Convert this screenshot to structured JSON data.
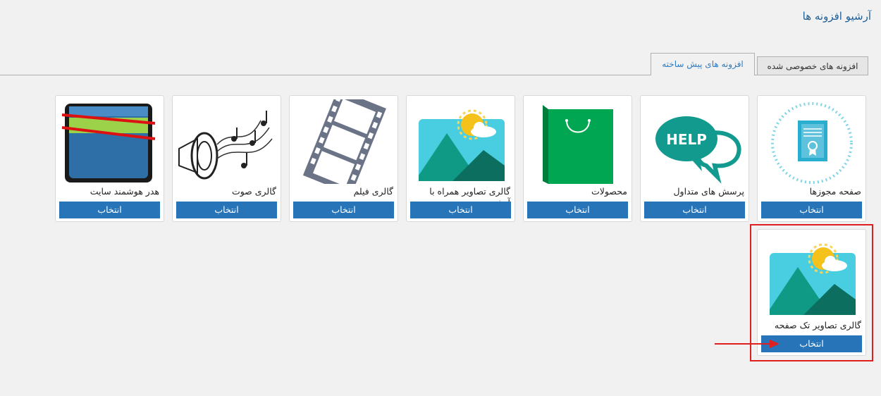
{
  "header": {
    "title": "آرشیو افزونه ها"
  },
  "tabs": [
    {
      "label": "افزونه های خصوصی شده",
      "active": false
    },
    {
      "label": "افزونه های پیش ساخته",
      "active": true
    }
  ],
  "cards": [
    {
      "label": "صفحه مجوزها",
      "button": "انتخاب",
      "icon": "certificate-icon"
    },
    {
      "label": "پرسش های متداول",
      "button": "انتخاب",
      "icon": "help-bubble-icon"
    },
    {
      "label": "محصولات",
      "button": "انتخاب",
      "icon": "shopping-bag-icon"
    },
    {
      "label": "گالری تصاویر همراه با آرشیو",
      "button": "انتخاب",
      "icon": "image-gallery-icon"
    },
    {
      "label": "گالری فیلم",
      "button": "انتخاب",
      "icon": "film-strip-icon"
    },
    {
      "label": "گالری صوت",
      "button": "انتخاب",
      "icon": "speaker-music-icon"
    },
    {
      "label": "هدر هوشمند سایت",
      "button": "انتخاب",
      "icon": "wallet-header-icon"
    },
    {
      "label": "گالری تصاویر تک صفحه",
      "button": "انتخاب",
      "icon": "image-gallery-icon"
    }
  ],
  "colors": {
    "accent": "#2874b8",
    "title": "#1d5f99",
    "highlight": "#e02020"
  }
}
